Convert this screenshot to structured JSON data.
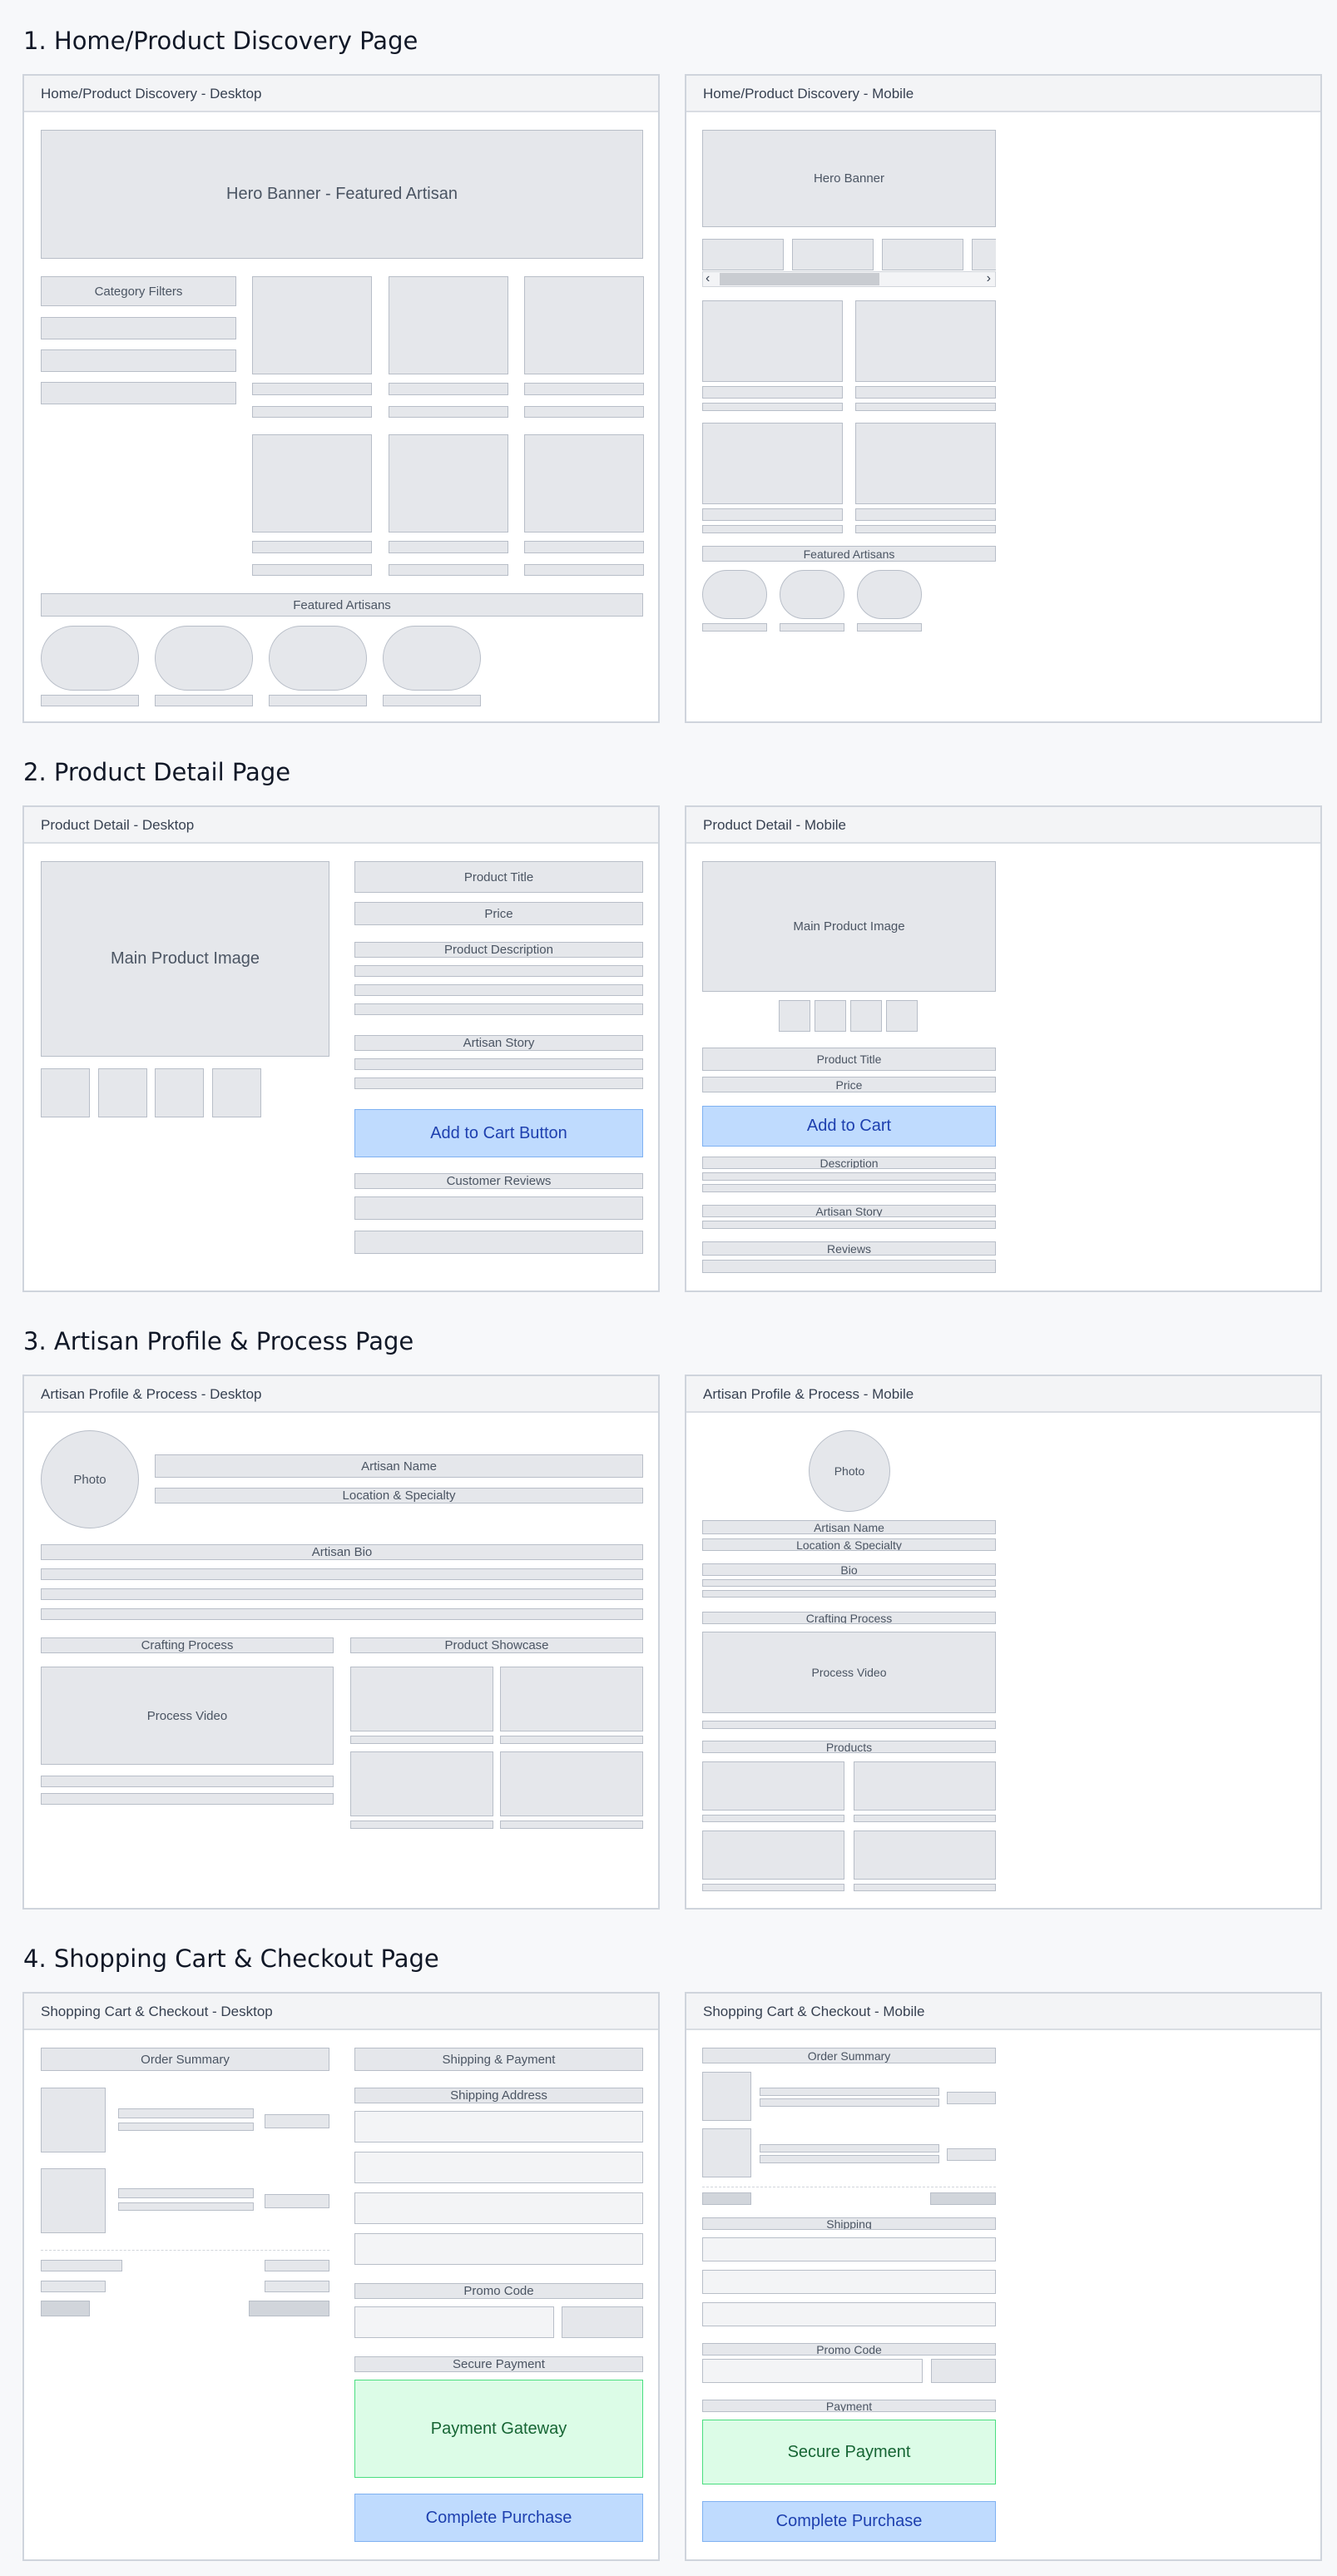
{
  "sections": [
    {
      "title": "1. Home/Product Discovery Page",
      "desktop": "Home/Product Discovery - Desktop",
      "mobile": "Home/Product Discovery - Mobile"
    },
    {
      "title": "2. Product Detail Page",
      "desktop": "Product Detail - Desktop",
      "mobile": "Product Detail - Mobile"
    },
    {
      "title": "3. Artisan Profile & Process Page",
      "desktop": "Artisan Profile & Process - Desktop",
      "mobile": "Artisan Profile & Process - Mobile"
    },
    {
      "title": "4. Shopping Cart & Checkout Page",
      "desktop": "Shopping Cart & Checkout - Desktop",
      "mobile": "Shopping Cart & Checkout - Mobile"
    }
  ],
  "home": {
    "hero_desktop": "Hero Banner - Featured Artisan",
    "category_filters": "Category Filters",
    "featured_artisans": "Featured Artisans",
    "hero_mobile": "Hero Banner",
    "featured_artisans_mobile": "Featured Artisans"
  },
  "detail": {
    "main_image": "Main Product Image",
    "title": "Product Title",
    "price": "Price",
    "description": "Product Description",
    "artisan_story": "Artisan Story",
    "add_to_cart_desktop": "Add to Cart Button",
    "customer_reviews": "Customer Reviews",
    "m_main_image": "Main Product Image",
    "m_title": "Product Title",
    "m_price": "Price",
    "m_add_to_cart": "Add to Cart",
    "m_description": "Description",
    "m_artisan_story": "Artisan Story",
    "m_reviews": "Reviews"
  },
  "profile": {
    "photo": "Photo",
    "artisan_name": "Artisan Name",
    "location": "Location & Specialty",
    "bio": "Artisan Bio",
    "crafting": "Crafting Process",
    "showcase": "Product Showcase",
    "process_video": "Process Video",
    "m_photo": "Photo",
    "m_name": "Artisan Name",
    "m_location": "Location & Specialty",
    "m_bio": "Bio",
    "m_crafting": "Crafting Process",
    "m_video": "Process Video",
    "m_products": "Products"
  },
  "checkout": {
    "order_summary": "Order Summary",
    "shipping_payment": "Shipping & Payment",
    "shipping_address": "Shipping Address",
    "promo_code": "Promo Code",
    "secure_payment": "Secure Payment",
    "payment_gateway": "Payment Gateway",
    "complete_purchase": "Complete Purchase",
    "m_order_summary": "Order Summary",
    "m_shipping": "Shipping",
    "m_promo": "Promo Code",
    "m_payment": "Payment",
    "m_secure_payment": "Secure Payment",
    "m_complete_purchase": "Complete Purchase"
  }
}
